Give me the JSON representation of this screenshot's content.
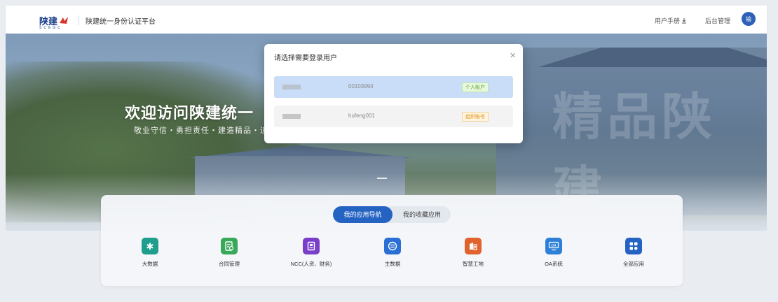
{
  "header": {
    "logo_text": "陕建",
    "logo_subtext": "SCEGC",
    "app_title": "陕建统一身份认证平台",
    "user_manual": "用户手册",
    "admin": "后台管理",
    "avatar_text": "输"
  },
  "hero": {
    "welcome": "欢迎访问陕建统一",
    "slogan": "敬业守信・勇担责任・建造精品・追",
    "watermark": "精品陕建"
  },
  "modal": {
    "title": "请选择需要登录用户",
    "accounts": [
      {
        "id": "00103994",
        "tag": "个人账户",
        "selected": true
      },
      {
        "id": "hufeng001",
        "tag": "组织账号",
        "selected": false
      }
    ]
  },
  "tabs": {
    "my_apps": "我的应用导航",
    "favorites": "我的收藏应用"
  },
  "apps": [
    {
      "label": "大数据",
      "color": "#1f9e8e",
      "icon": "snowflake-icon"
    },
    {
      "label": "合同管理",
      "color": "#38a85a",
      "icon": "contract-icon"
    },
    {
      "label": "NCC(人资、财务)",
      "color": "#7a3fc9",
      "icon": "document-icon"
    },
    {
      "label": "主数据",
      "color": "#2a6fd3",
      "icon": "database-icon"
    },
    {
      "label": "智慧工地",
      "color": "#e0622d",
      "icon": "building-icon"
    },
    {
      "label": "OA系统",
      "color": "#2d7fd8",
      "icon": "oa-monitor-icon"
    },
    {
      "label": "全部应用",
      "color": "#2563c2",
      "icon": "grid-icon"
    }
  ],
  "colors": {
    "primary": "#2563c2",
    "selected_row": "#c9dcf8"
  }
}
